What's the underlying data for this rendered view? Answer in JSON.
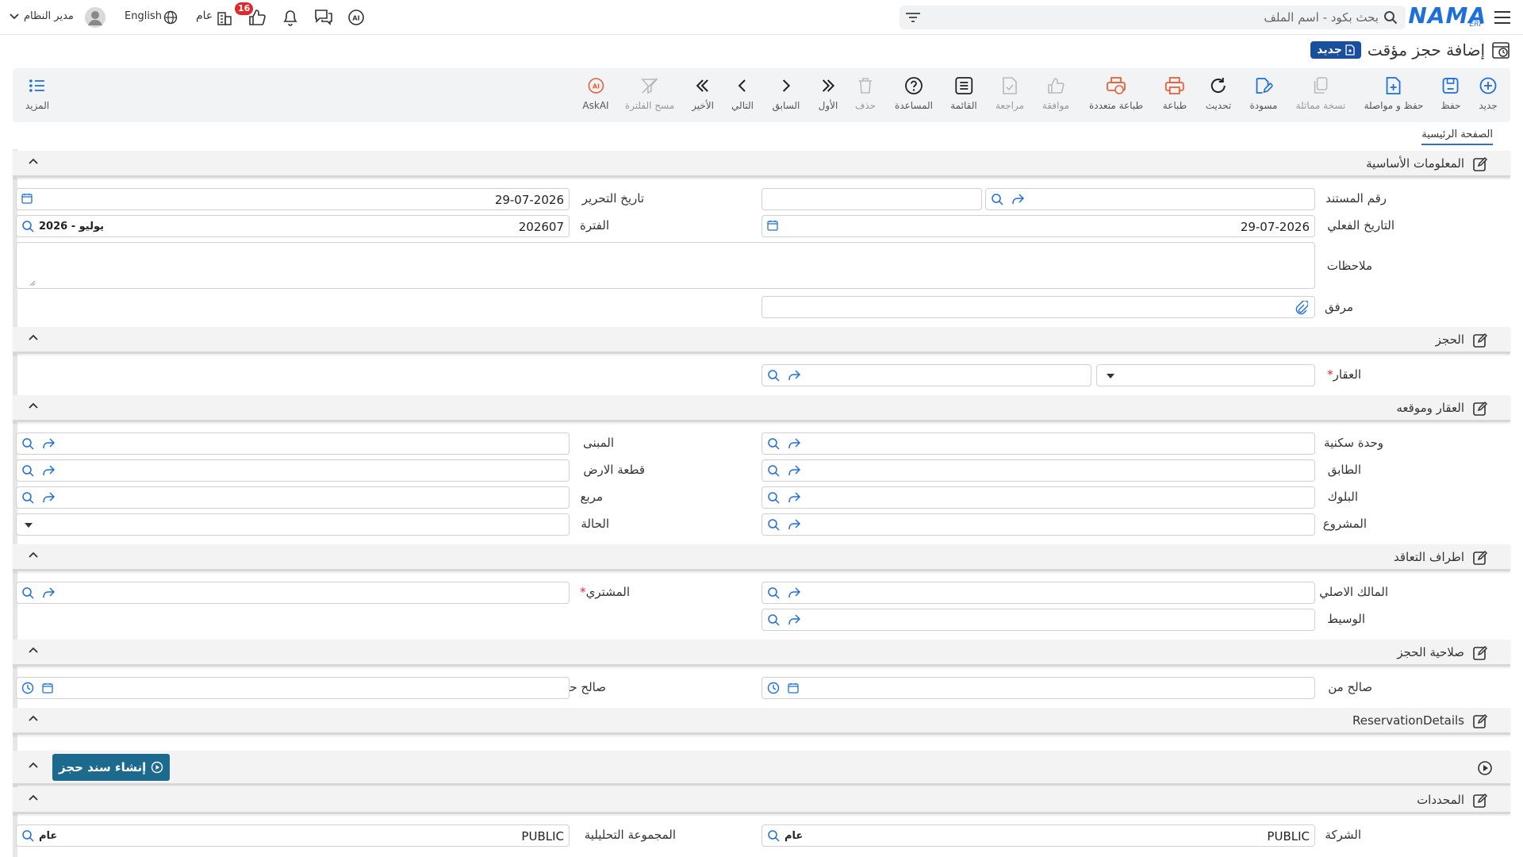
{
  "topbar": {
    "search_placeholder": "بحث بكود - اسم الملف",
    "logo_text": "NAMA",
    "logo_sub": "ERP",
    "notification_count": "16",
    "branch_label": "عام",
    "language_label": "English",
    "user_name": "مدير النظام"
  },
  "page": {
    "title": "إضافة حجز مؤقت",
    "new_badge": "جديد"
  },
  "toolbar": {
    "new": "جديد",
    "save": "حفظ",
    "save_continue": "حفظ و مواصلة",
    "copy": "نسخة مماثلة",
    "draft": "مسودة",
    "refresh": "تحديث",
    "print": "طباعة",
    "multi_print": "طباعة متعددة",
    "approve": "موافقة",
    "review": "مراجعة",
    "list": "القائمة",
    "help": "المساعدة",
    "delete": "حذف",
    "first": "الأول",
    "prev": "السابق",
    "next": "التالي",
    "last": "الأخير",
    "clear_filter": "مسح الفلترة",
    "askai": "AskAI",
    "more": "المزيد"
  },
  "tabs": {
    "main": "الصفحة الرئيسية"
  },
  "sections": {
    "basic": "المعلومات الأساسية",
    "reservation": "الحجز",
    "property_location": "العقار وموقعه",
    "parties": "اطراف التعاقد",
    "validity": "صلاحية الحجز",
    "details": "ReservationDetails",
    "dimensions": "المحددات"
  },
  "labels": {
    "doc_number": "رقم المستند",
    "edit_date": "تاريخ التحرير",
    "actual_date": "التاريخ الفعلي",
    "period": "الفترة",
    "notes": "ملاحظات",
    "attachment": "مرفق",
    "property": "العقار",
    "unit": "وحدة سكنية",
    "building": "المبنى",
    "floor": "الطابق",
    "land_plot": "قطعة الارض",
    "block": "البلوك",
    "square": "مربع",
    "project": "المشروع",
    "status": "الحالة",
    "original_owner": "المالك الاصلي",
    "buyer": "المشتري",
    "broker": "الوسيط",
    "valid_from": "صالح من",
    "valid_to": "صالح حتي",
    "company": "الشركة",
    "analytic_group": "المجموعة التحليلية"
  },
  "values": {
    "edit_date": "29-07-2026",
    "actual_date": "29-07-2026",
    "period_code": "202607",
    "period_name": "2026 - يوليو",
    "company_code": "PUBLIC",
    "company_name": "عام",
    "analytic_code": "PUBLIC",
    "analytic_name": "عام"
  },
  "buttons": {
    "create_voucher": "إنشاء سند حجز"
  },
  "colors": {
    "brand": "#1e6fd9",
    "accent_orange": "#e8613a",
    "action_button": "#1d6a8f",
    "badge_red": "#e3262a"
  }
}
